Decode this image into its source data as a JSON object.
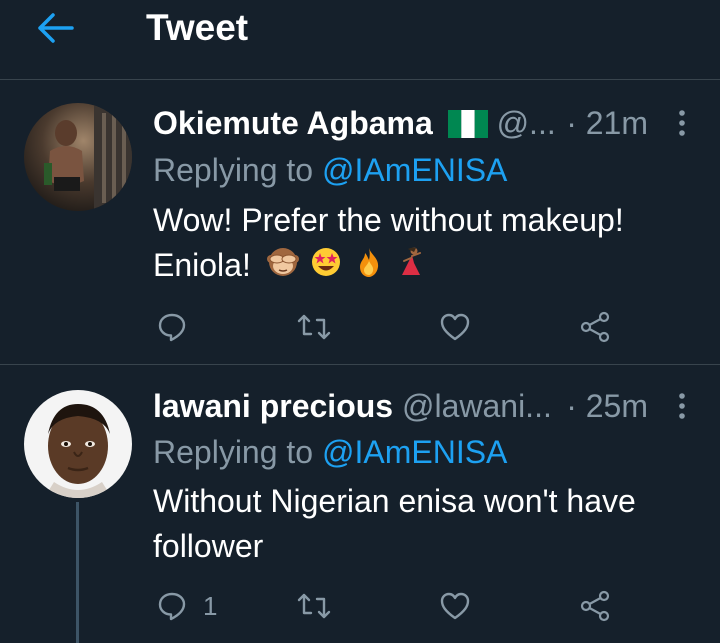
{
  "topbar": {
    "title": "Tweet",
    "back_icon": "arrow-left-icon"
  },
  "colors": {
    "background": "#15202b",
    "accent": "#1da1f2",
    "muted": "#8899a6",
    "divider": "#38444d"
  },
  "tweets": [
    {
      "display_name": "Okiemute Agbama",
      "flag_icon": "nigeria-flag-icon",
      "handle": "@...",
      "time": "· 21m",
      "replying_prefix": "Replying to ",
      "replying_to": "@IAmENISA",
      "text_line1": "Wow! Prefer the without makeup!",
      "text_line2": "Eniola!",
      "emojis": [
        "see-no-evil-monkey-icon",
        "star-struck-icon",
        "fire-icon",
        "dancer-icon"
      ],
      "reply_count": "",
      "retweet_count": "",
      "like_count": ""
    },
    {
      "display_name": "lawani precious",
      "handle": "@lawani...",
      "time": "· 25m",
      "replying_prefix": "Replying to ",
      "replying_to": "@IAmENISA",
      "text_line1": "Without Nigerian enisa won't have",
      "text_line2": "follower",
      "reply_count": "1",
      "retweet_count": "",
      "like_count": ""
    }
  ]
}
